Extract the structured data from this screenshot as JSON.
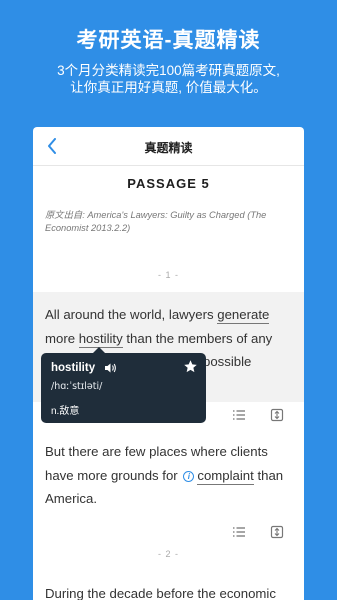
{
  "promo": {
    "title": "考研英语-真题精读",
    "subtitle_line1": "3个月分类精读完100篇考研真题原文,",
    "subtitle_line2": "让你真正用好真题, 价值最大化。"
  },
  "navbar": {
    "title": "真题精读",
    "back_icon": "chevron-left-icon"
  },
  "passage": {
    "title": "PASSAGE  5",
    "source": "原文出自: America's Lawyers: Guilty as Charged (The Economist 2013.2.2)",
    "section1_label": "- 1 -",
    "section2_label": "- 2 -",
    "para1": {
      "line1_pre": "All around the world, lawyers ",
      "line1_word": "generate",
      "line2_pre": "more ",
      "line2_word": "hostility",
      "line2_post": " than the members of any",
      "line3": "the possible",
      "line4": "n."
    },
    "para2": {
      "line1": "But there are few places where clients",
      "line2_pre": "have more grounds for ",
      "line2_word": "complaint",
      "line2_post": " than",
      "line3": "America."
    },
    "para3": {
      "line1": "During the decade before the economic"
    }
  },
  "popup": {
    "word": "hostility",
    "phonetic": "/hɑːˈstɪləti/",
    "definition": "n.敌意",
    "icons": [
      "speaker-icon",
      "star-icon"
    ]
  },
  "colors": {
    "brand_blue": "#2f8ee6",
    "popup_bg": "#1f2d3a"
  }
}
